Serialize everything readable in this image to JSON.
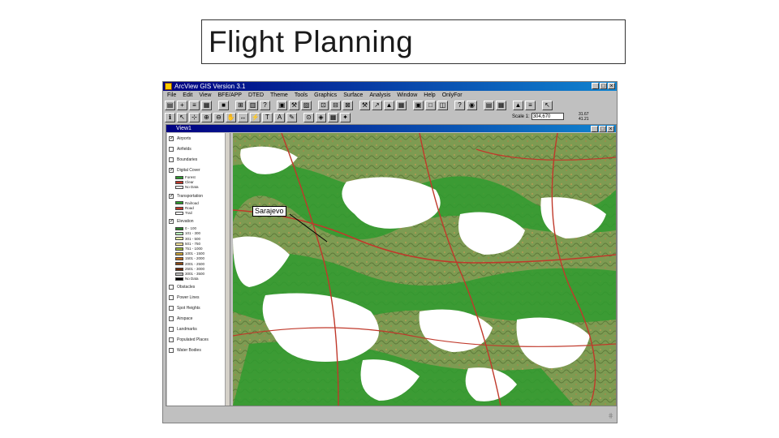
{
  "slide": {
    "title": "Flight Planning"
  },
  "window": {
    "title": "ArcView GIS Version 3.1",
    "buttons": [
      "_",
      "□",
      "×"
    ]
  },
  "menu": [
    "File",
    "Edit",
    "View",
    "BFE/APP",
    "DTED",
    "Theme",
    "Tools",
    "Graphics",
    "Surface",
    "Analysis",
    "Window",
    "Help",
    "OnlyFor"
  ],
  "toolbar": {
    "scale_label": "Scale 1:",
    "scale_value": "304,670",
    "coords": [
      "31.67",
      "41.21"
    ]
  },
  "view": {
    "title": "View1",
    "callout": "Sarajevo",
    "colors": {
      "forest": "#2a9b2a",
      "terrain": "#7a9a4a",
      "water": "#ffffff",
      "roads": "#c0392b"
    }
  },
  "toc": [
    {
      "label": "Airports",
      "checked": true
    },
    {
      "label": "Airfields",
      "checked": false
    },
    {
      "label": "Boundaries",
      "checked": false
    },
    {
      "label": "Digital Cover",
      "checked": true,
      "legend": [
        "Forest",
        "Clear",
        "No Data"
      ]
    },
    {
      "label": "Transportation",
      "checked": true,
      "legend": [
        "Railroad",
        "Road",
        "Trail"
      ]
    },
    {
      "label": "Elevation",
      "checked": true,
      "legend": [
        "0 - 100",
        "101 - 300",
        "301 - 500",
        "501 - 750",
        "751 - 1000",
        "1001 - 1500",
        "1501 - 2000",
        "2001 - 2500",
        "2501 - 3000",
        "3001 - 3500",
        "No Data"
      ],
      "legend_colors": [
        "#2e7d2e",
        "#b6f0b6",
        "#e8f2a6",
        "#f4e49c",
        "#9ab33c",
        "#c8a034",
        "#b86a1c",
        "#8a4a16",
        "#6a2a0a",
        "#bdbdbd",
        "#000000"
      ]
    },
    {
      "label": "Obstacles",
      "checked": false
    },
    {
      "label": "Power Lines",
      "checked": false
    },
    {
      "label": "Spot Heights",
      "checked": false
    },
    {
      "label": "Airspace",
      "checked": false
    },
    {
      "label": "Landmarks",
      "checked": false
    },
    {
      "label": "Populated Places",
      "checked": false
    },
    {
      "label": "Water Bodies",
      "checked": false
    }
  ]
}
